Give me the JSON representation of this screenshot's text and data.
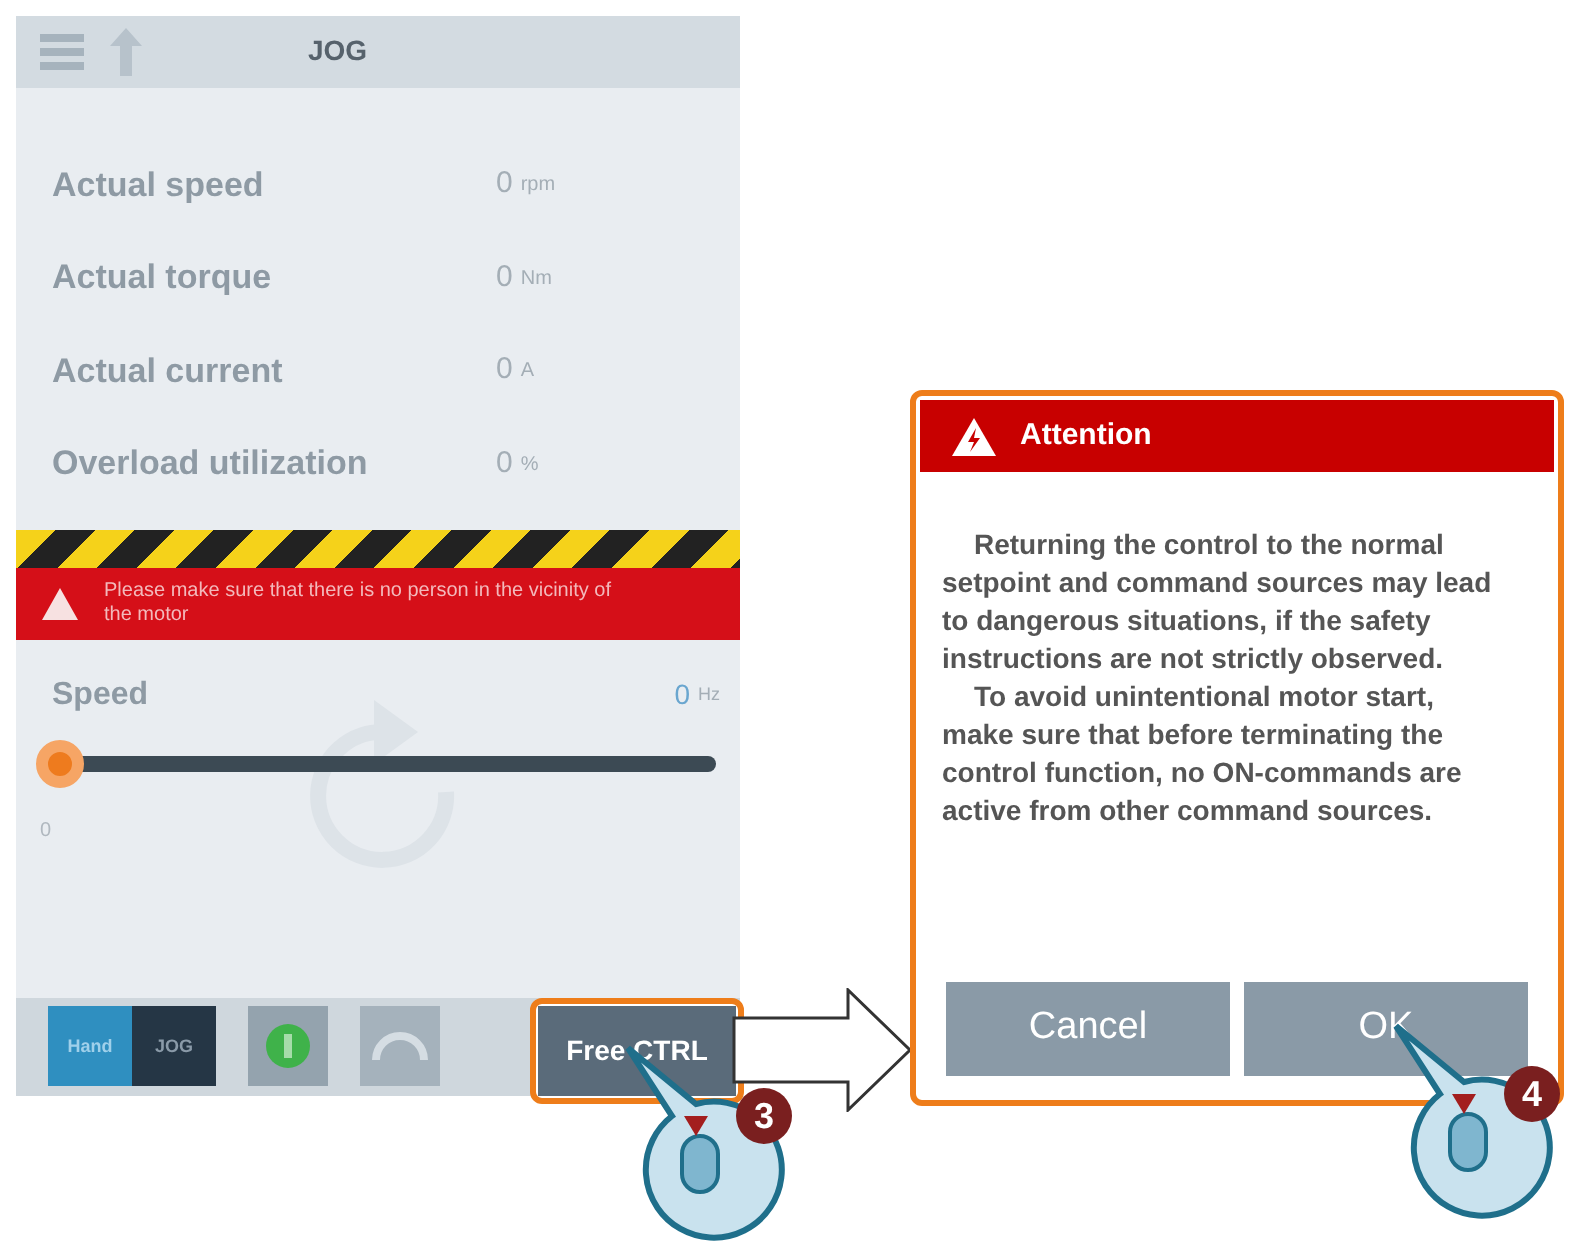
{
  "panel": {
    "title": "JOG",
    "readings": [
      {
        "label": "Actual speed",
        "value": "0",
        "unit": "rpm"
      },
      {
        "label": "Actual torque",
        "value": "0",
        "unit": "Nm"
      },
      {
        "label": "Actual current",
        "value": "0",
        "unit": "A"
      },
      {
        "label": "Overload utilization",
        "value": "0",
        "unit": "%"
      }
    ],
    "warning": "Please make sure that there is no person in the vicinity of the motor",
    "speed": {
      "label": "Speed",
      "value": "0",
      "unit": "Hz",
      "level": 0.0,
      "min": "0"
    },
    "mode_switch": [
      {
        "label": "Hand",
        "selected": true
      },
      {
        "label": "JOG",
        "selected": false
      }
    ],
    "free_ctrl_button": "Free CTRL"
  },
  "dialog": {
    "title": "Attention",
    "paragraphs": [
      "Returning the control to the normal setpoint and command sources may lead to dangerous situations, if the safety instructions are not strictly observed.",
      "To avoid unintentional motor start, make sure that before terminating the control function, no ON-commands are active from other command sources."
    ],
    "buttons": [
      "Cancel",
      "OK"
    ]
  },
  "steps": [
    {
      "number": "3"
    },
    {
      "number": "4"
    }
  ]
}
